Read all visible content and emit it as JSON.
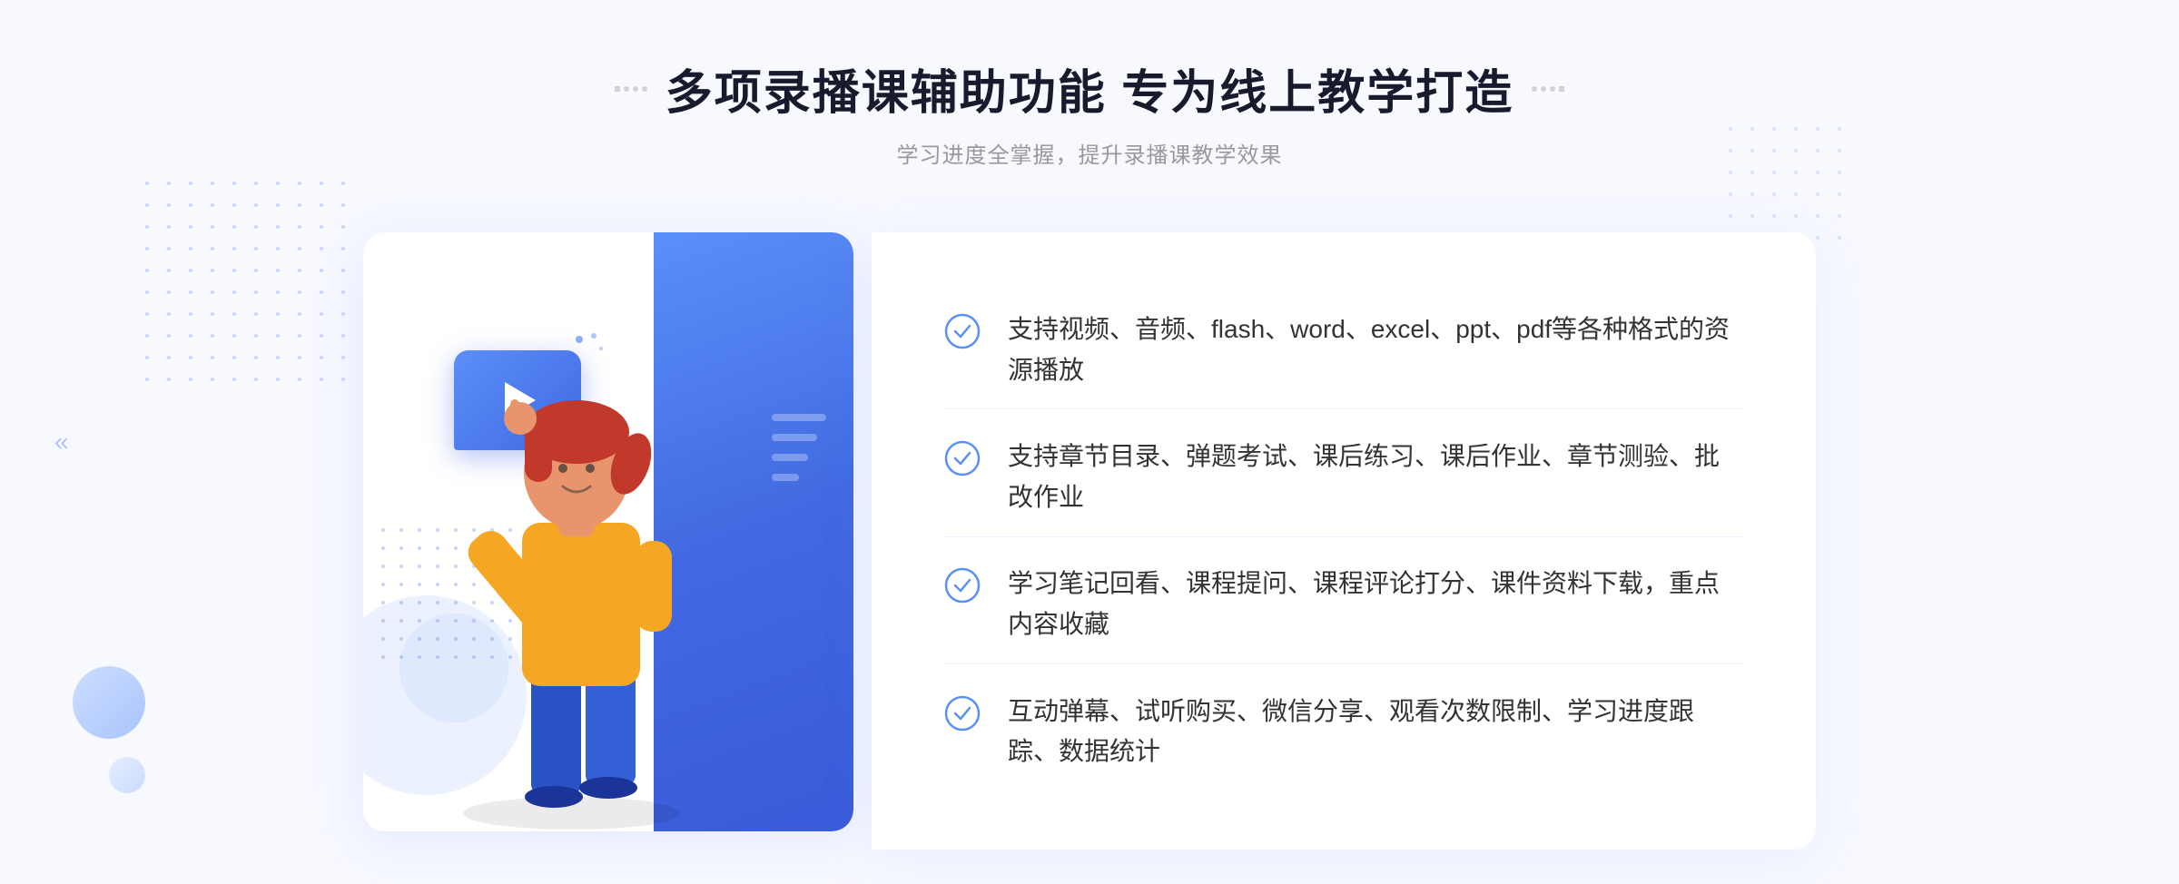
{
  "header": {
    "title": "多项录播课辅助功能 专为线上教学打造",
    "subtitle": "学习进度全掌握，提升录播课教学效果",
    "left_decorator": "decorative",
    "right_decorator": "decorative"
  },
  "features": [
    {
      "id": 1,
      "text": "支持视频、音频、flash、word、excel、ppt、pdf等各种格式的资源播放"
    },
    {
      "id": 2,
      "text": "支持章节目录、弹题考试、课后练习、课后作业、章节测验、批改作业"
    },
    {
      "id": 3,
      "text": "学习笔记回看、课程提问、课程评论打分、课件资料下载，重点内容收藏"
    },
    {
      "id": 4,
      "text": "互动弹幕、试听购买、微信分享、观看次数限制、学习进度跟踪、数据统计"
    }
  ],
  "colors": {
    "primary": "#4169e1",
    "primary_light": "#5b8ff9",
    "primary_pale": "#a0c4ff",
    "text_dark": "#1a1a2e",
    "text_medium": "#333333",
    "text_light": "#999999",
    "bg": "#f8f9ff",
    "white": "#ffffff"
  },
  "icons": {
    "check": "check-circle-icon",
    "play": "play-icon",
    "arrow_left": "chevron-left-icon",
    "grid_dots_left": "decorative-dots-left",
    "grid_dots_right": "decorative-dots-right"
  }
}
